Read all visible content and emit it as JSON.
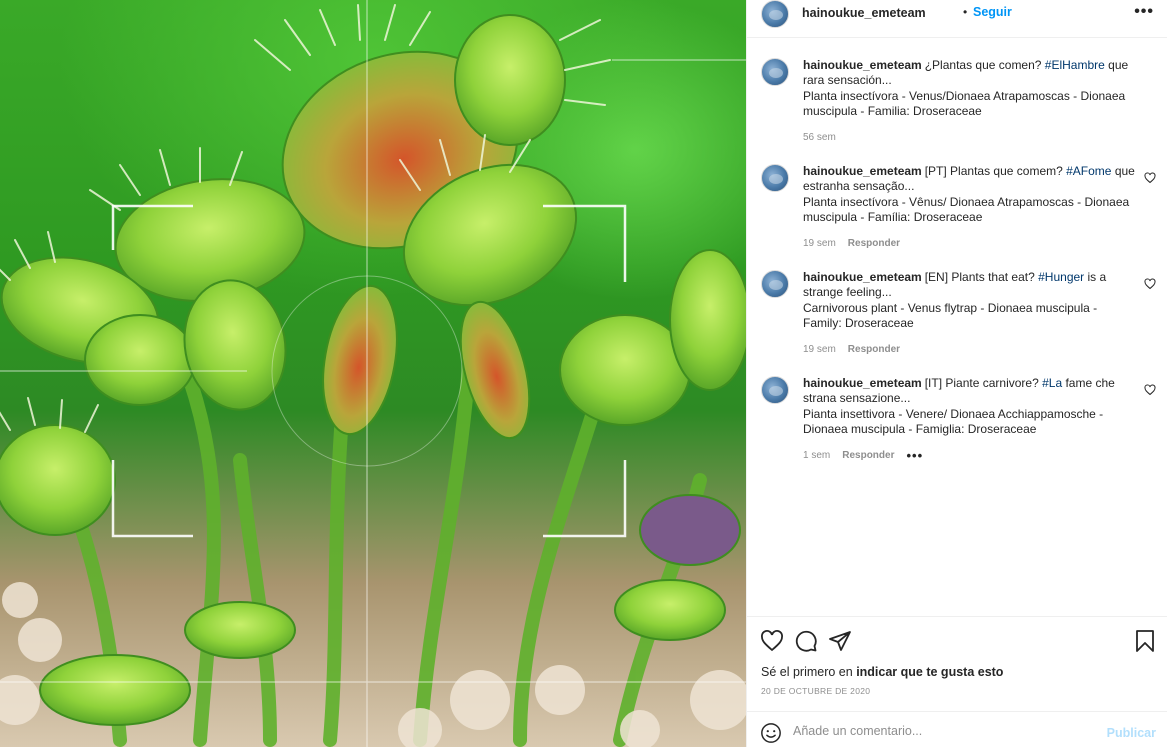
{
  "post": {
    "username": "hainoukue_emeteam",
    "separator": "•",
    "follow_label": "Seguir",
    "more_label": "•••"
  },
  "comments": [
    {
      "username": "hainoukue_emeteam",
      "text_before": "¿Plantas que comen? ",
      "hashtag": "#ElHambre",
      "text_after": " que rara sensación...",
      "line2": "Planta insectívora - Venus/Dionaea Atrapamoscas - Dionaea muscipula - Familia: Droseraceae",
      "time": "56 sem",
      "reply": "",
      "has_heart": false
    },
    {
      "username": "hainoukue_emeteam",
      "text_before": "[PT] Plantas que comem? ",
      "hashtag": "#AFome",
      "text_after": " que estranha sensação...",
      "line2": "Planta insectívora - Vênus/ Dionaea Atrapamoscas - Dionaea muscipula - Família: Droseraceae",
      "time": "19 sem",
      "reply": "Responder",
      "has_heart": true
    },
    {
      "username": "hainoukue_emeteam",
      "text_before": "[EN] Plants that eat? ",
      "hashtag": "#Hunger",
      "text_after": " is a strange feeling...",
      "line2": "Carnivorous plant - Venus flytrap - Dionaea muscipula - Family: Droseraceae",
      "time": "19 sem",
      "reply": "Responder",
      "has_heart": true
    },
    {
      "username": "hainoukue_emeteam",
      "text_before": "[IT] Piante carnivore? ",
      "hashtag": "#La",
      "text_after": " fame che strana sensazione...",
      "line2": "Pianta insettivora - Venere/ Dionaea Acchiappamosche - Dionaea muscipula - Famiglia: Droseraceae",
      "time": "1 sem",
      "reply": "Responder",
      "more": "•••",
      "has_heart": true
    }
  ],
  "actions": {
    "like_prefix": "Sé el primero en ",
    "like_link": "indicar que te gusta esto",
    "date": "20 DE OCTUBRE DE 2020"
  },
  "composer": {
    "placeholder": "Añade un comentario...",
    "publish_label": "Publicar"
  },
  "colors": {
    "link_blue": "#0095f6",
    "hashtag_blue": "#00376b",
    "muted_gray": "#8e8e8e",
    "publish_disabled": "#b2dffc"
  },
  "icons": [
    "heart-icon",
    "comment-icon",
    "share-icon",
    "bookmark-icon",
    "emoji-icon",
    "more-icon"
  ]
}
